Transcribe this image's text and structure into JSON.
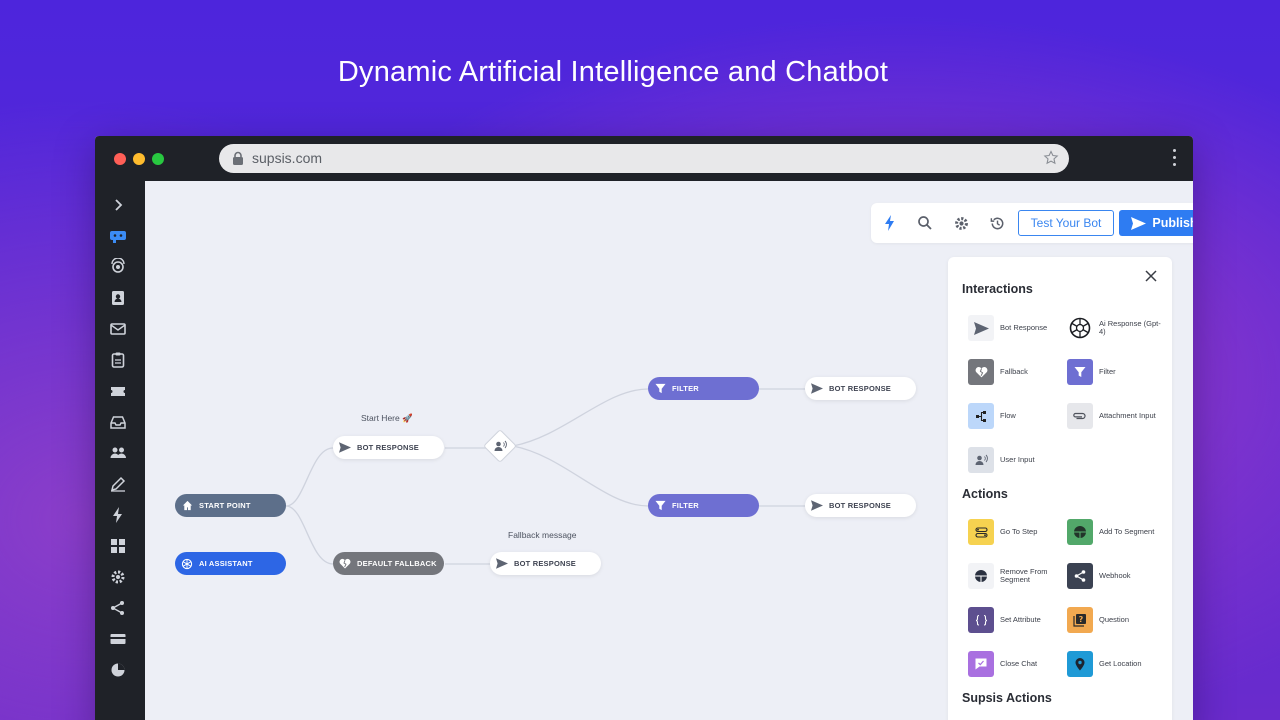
{
  "hero": {
    "title": "Dynamic Artificial Intelligence and Chatbot"
  },
  "browser": {
    "url": "supsis.com"
  },
  "toolbar": {
    "test_label": "Test Your Bot",
    "publish_label": "Publish"
  },
  "flow": {
    "start_point": "START POINT",
    "ai_assistant": "AI ASSISTANT",
    "bot_response": "BOT RESPONSE",
    "default_fallback": "DEFAULT FALLBACK",
    "filter": "FILTER",
    "start_here": "Start Here 🚀",
    "fallback_message": "Fallback message"
  },
  "panel": {
    "interactions_title": "Interactions",
    "actions_title": "Actions",
    "supsis_actions_title": "Supsis Actions",
    "interactions": [
      {
        "label": "Bot Response",
        "icon": "send-icon"
      },
      {
        "label": "Ai Response (Gpt-4)",
        "icon": "openai-icon"
      },
      {
        "label": "Fallback",
        "icon": "broken-heart-icon"
      },
      {
        "label": "Filter",
        "icon": "filter-icon"
      },
      {
        "label": "Flow",
        "icon": "flow-icon"
      },
      {
        "label": "Attachment Input",
        "icon": "paperclip-icon"
      },
      {
        "label": "User Input",
        "icon": "user-voice-icon"
      }
    ],
    "actions": [
      {
        "label": "Go To Step",
        "icon": "go-to-step-icon"
      },
      {
        "label": "Add To Segment",
        "icon": "segment-add-icon"
      },
      {
        "label": "Remove From Segment",
        "icon": "segment-remove-icon"
      },
      {
        "label": "Webhook",
        "icon": "share-icon"
      },
      {
        "label": "Set Attribute",
        "icon": "braces-icon"
      },
      {
        "label": "Question",
        "icon": "question-icon"
      },
      {
        "label": "Close Chat",
        "icon": "close-chat-icon"
      },
      {
        "label": "Get Location",
        "icon": "location-icon"
      }
    ]
  },
  "colors": {
    "accent_blue": "#2e7cf2",
    "node_purple": "#6e6fd2",
    "node_dark": "#5d6f8a"
  }
}
